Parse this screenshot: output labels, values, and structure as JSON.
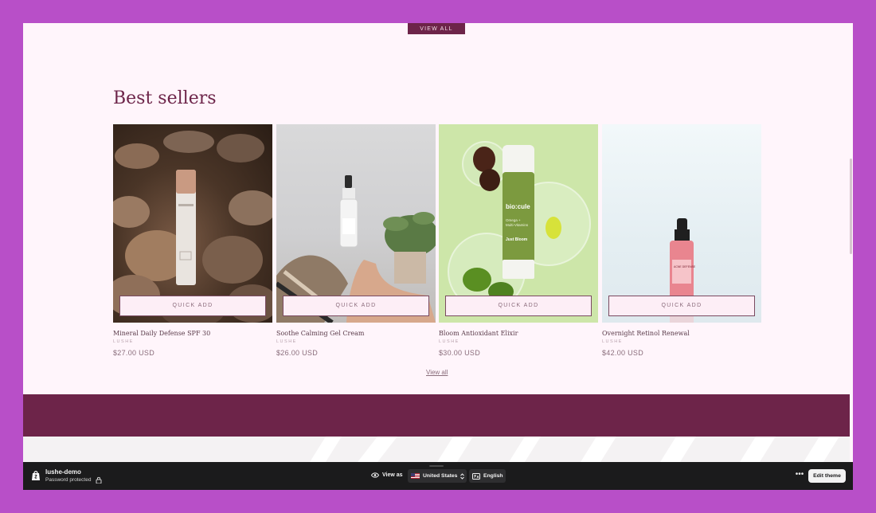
{
  "top_button": {
    "label": "VIEW ALL"
  },
  "section": {
    "title": "Best sellers",
    "quick_add_label": "QUICK ADD",
    "view_all_label": "View all"
  },
  "products": [
    {
      "name": "Mineral Daily Defense SPF 30",
      "vendor": "LUSHE",
      "price": "$27.00 USD"
    },
    {
      "name": "Soothe Calming Gel Cream",
      "vendor": "LUSHE",
      "price": "$26.00 USD"
    },
    {
      "name": "Bloom Antioxidant Elixir",
      "vendor": "LUSHE",
      "price": "$30.00 USD"
    },
    {
      "name": "Overnight Retinol Renewal",
      "vendor": "LUSHE",
      "price": "$42.00 USD"
    }
  ],
  "product_image_labels": {
    "bio_brand": "bio:cule",
    "bio_line1": "Omega +",
    "bio_line2": "Multi-Vitamins",
    "bio_product": "Just Bloom",
    "acne_label": "ACNE DEFENSE"
  },
  "admin_bar": {
    "store_name": "lushe-demo",
    "status": "Password protected",
    "view_as_label": "View as",
    "country": "United States",
    "language": "English",
    "more_label": "•••",
    "edit_theme_label": "Edit theme"
  },
  "colors": {
    "accent": "#6d2449",
    "page_background": "#fff5fb",
    "outer_background": "#b84fc8",
    "admin_bar": "#1b1b1c"
  },
  "icons": [
    "shopify-bag-icon",
    "lock-icon",
    "eye-icon",
    "us-flag-icon",
    "chevron-updown-icon",
    "translate-icon",
    "ellipsis-icon"
  ]
}
